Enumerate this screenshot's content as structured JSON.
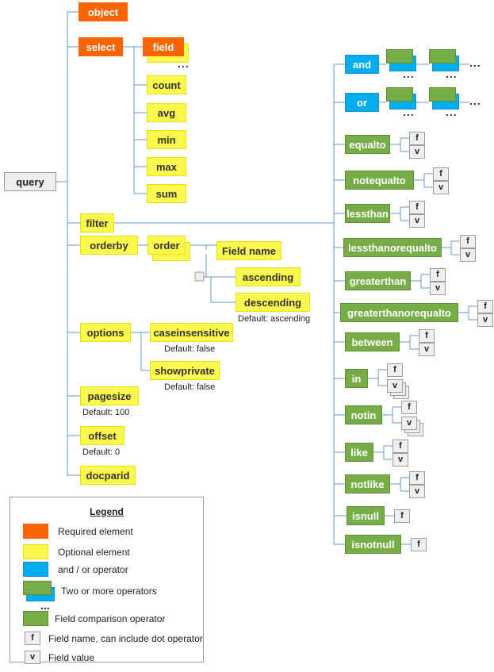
{
  "diagram": {
    "title": "query",
    "root": {
      "label": "query"
    },
    "level1": [
      {
        "label": "object",
        "type": "required"
      },
      {
        "label": "select",
        "type": "required"
      },
      {
        "label": "filter",
        "type": "optional"
      },
      {
        "label": "orderby",
        "type": "optional"
      },
      {
        "label": "options",
        "type": "optional"
      },
      {
        "label": "pagesize",
        "type": "optional",
        "note": "Default: 100"
      },
      {
        "label": "offset",
        "type": "optional",
        "note": "Default: 0"
      },
      {
        "label": "docparid",
        "type": "optional"
      }
    ],
    "select_children": [
      {
        "label": "field",
        "type": "required",
        "stacked": true
      },
      {
        "label": "count",
        "type": "optional"
      },
      {
        "label": "avg",
        "type": "optional"
      },
      {
        "label": "min",
        "type": "optional"
      },
      {
        "label": "max",
        "type": "optional"
      },
      {
        "label": "sum",
        "type": "optional"
      }
    ],
    "orderby_children": [
      {
        "label": "order",
        "type": "optional",
        "stacked": true
      }
    ],
    "order_children": [
      {
        "label": "Field name",
        "type": "optional"
      },
      {
        "label": "ascending",
        "type": "optional"
      },
      {
        "label": "descending",
        "type": "optional",
        "note": "Default: ascending"
      }
    ],
    "options_children": [
      {
        "label": "caseinsensitive",
        "type": "optional",
        "note": "Default: false"
      },
      {
        "label": "showprivate",
        "type": "optional",
        "note": "Default: false"
      }
    ],
    "filter_children": [
      {
        "label": "and",
        "type": "andor",
        "operands": "two-or-more"
      },
      {
        "label": "or",
        "type": "andor",
        "operands": "two-or-more"
      },
      {
        "label": "equalto",
        "type": "compare",
        "chips": [
          "f",
          "v"
        ]
      },
      {
        "label": "notequalto",
        "type": "compare",
        "chips": [
          "f",
          "v"
        ]
      },
      {
        "label": "lessthan",
        "type": "compare",
        "chips": [
          "f",
          "v"
        ]
      },
      {
        "label": "lessthanorequalto",
        "type": "compare",
        "chips": [
          "f",
          "v"
        ]
      },
      {
        "label": "greaterthan",
        "type": "compare",
        "chips": [
          "f",
          "v"
        ]
      },
      {
        "label": "greaterthanorequalto",
        "type": "compare",
        "chips": [
          "f",
          "v"
        ]
      },
      {
        "label": "between",
        "type": "compare",
        "chips": [
          "f",
          "v"
        ]
      },
      {
        "label": "in",
        "type": "compare",
        "chips": [
          "f",
          "v"
        ],
        "value_stacked": true
      },
      {
        "label": "notin",
        "type": "compare",
        "chips": [
          "f",
          "v"
        ],
        "value_stacked": true
      },
      {
        "label": "like",
        "type": "compare",
        "chips": [
          "f",
          "v"
        ]
      },
      {
        "label": "notlike",
        "type": "compare",
        "chips": [
          "f",
          "v"
        ]
      },
      {
        "label": "isnull",
        "type": "compare",
        "chips": [
          "f"
        ]
      },
      {
        "label": "isnotnull",
        "type": "compare",
        "chips": [
          "f"
        ]
      }
    ],
    "chips": {
      "field": "f",
      "value": "v"
    },
    "ellipsis": "..."
  },
  "legend": {
    "title": "Legend",
    "items": [
      {
        "label": "Required element",
        "swatch": "required"
      },
      {
        "label": "Optional element",
        "swatch": "optional"
      },
      {
        "label": "and / or operator",
        "swatch": "andor"
      },
      {
        "label": "Two or more operators",
        "swatch": "two-or-more"
      },
      {
        "label": "Field comparison operator",
        "swatch": "compare"
      },
      {
        "label": "Field name, can include dot operator",
        "swatch": "chip-f",
        "chip": "f"
      },
      {
        "label": "Field value",
        "swatch": "chip-v",
        "chip": "v"
      }
    ]
  },
  "colors": {
    "required": "#FA6400",
    "optional": "#FCF94E",
    "andor": "#00AEEF",
    "compare": "#76AD47",
    "root": "#EEEEEE",
    "chip": "#EFEFEF",
    "wire": "#6699CC"
  }
}
